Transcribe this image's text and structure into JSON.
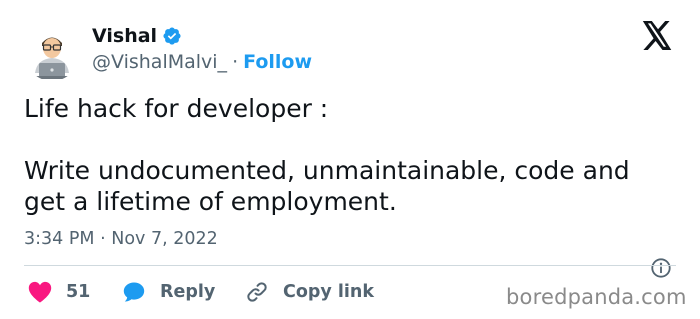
{
  "author": {
    "name": "Vishal",
    "handle": "@VishalMalvi_",
    "separator": "·",
    "follow_label": "Follow"
  },
  "tweet": {
    "text": "Life hack for developer :\n\nWrite undocumented, unmaintainable, code and get a lifetime of employment.",
    "time": "3:34 PM",
    "date": "Nov 7, 2022",
    "meta_separator": "·"
  },
  "actions": {
    "like_count": "51",
    "reply_label": "Reply",
    "copy_link_label": "Copy link"
  },
  "watermark": "boredpanda.com",
  "colors": {
    "accent": "#1d9bf0",
    "like": "#f91880",
    "text": "#0f1419",
    "muted": "#536471"
  },
  "icons": {
    "verified": "verified-badge-icon",
    "platform": "x-logo-icon",
    "info": "info-icon",
    "like": "heart-icon",
    "reply": "speech-bubble-icon",
    "copy": "link-icon"
  }
}
